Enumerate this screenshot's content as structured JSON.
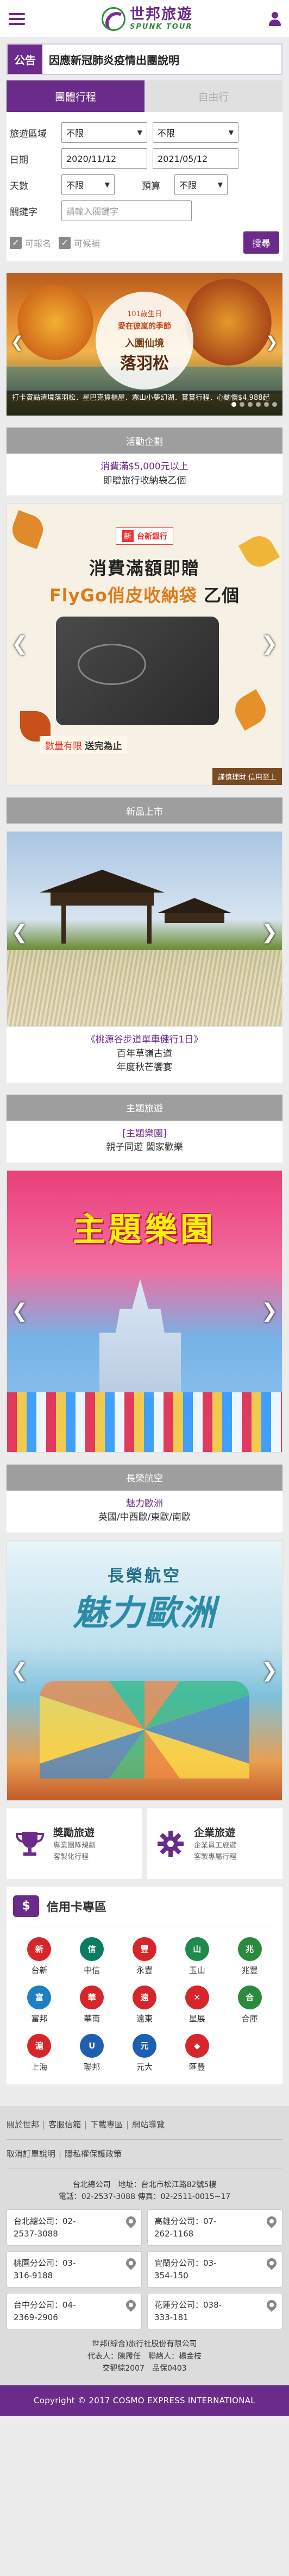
{
  "header": {
    "logo_cn": "世邦旅遊",
    "logo_en": "SPUNK TOUR"
  },
  "notice": {
    "tag": "公告",
    "text": "因應新冠肺炎疫情出團說明"
  },
  "search": {
    "tabs": [
      "團體行程",
      "自由行"
    ],
    "region_label": "旅遊區域",
    "region_value": "不限",
    "region_value2": "不限",
    "date_label": "日期",
    "date_from": "2020/11/12",
    "date_to": "2021/05/12",
    "days_label": "天數",
    "days_value": "不限",
    "budget_label": "預算",
    "budget_value": "不限",
    "keyword_label": "關鍵字",
    "keyword_placeholder": "請輸入關鍵字",
    "check_available": "可報名",
    "check_waitlist": "可候補",
    "search_button": "搜尋"
  },
  "banner": {
    "badge_line1": "101歲生日",
    "badge_line2": "愛在彼嵐的季節",
    "badge_line3": "入園仙境",
    "badge_line4": "落羽松",
    "caption": "打卡賞點清境落羽松．星巴克貨櫃屋．霧山小夢幻湖．賞賞行程．心動價$4,988起"
  },
  "activity": {
    "section_title": "活動企劃",
    "link_line1": "消費滿$5,000元以上",
    "link_line2": "即贈旅行收納袋乙個",
    "bank_name": "台新銀行",
    "headline1": "消費滿額即贈",
    "headline2": "FlyGo俏皮收納袋",
    "headline2_suffix": "乙個",
    "note_prefix": "數量有限",
    "note_suffix": "送完為止",
    "tag": "謹慎理財 信用至上"
  },
  "new_products": {
    "section_title": "新品上市",
    "link_line1": "《桃源谷步道單車健行1日》",
    "link_line2": "百年草嶺古道",
    "link_line3": "年度秋芒饗宴"
  },
  "theme_travel": {
    "section_title": "主題旅遊",
    "link_line1": "[主題樂園]",
    "link_line2": "親子同遊 闔家歡樂",
    "image_title": "主題樂園"
  },
  "airline": {
    "section_title": "長榮航空",
    "link_line1": "魅力歐洲",
    "link_line2": "英國/中西歐/東歐/南歐",
    "image_line1": "長榮航空",
    "image_line2": "魅力歐洲"
  },
  "services": [
    {
      "title": "獎勵旅遊",
      "sub1": "專業團隊規劃",
      "sub2": "客製化行程"
    },
    {
      "title": "企業旅遊",
      "sub1": "企業員工旅遊",
      "sub2": "客製專屬行程"
    }
  ],
  "credit": {
    "icon": "$",
    "title": "信用卡專區",
    "banks": [
      "台新",
      "中信",
      "永豐",
      "玉山",
      "兆豐",
      "富邦",
      "華南",
      "遠東",
      "星展",
      "合庫",
      "上海",
      "聯邦",
      "元大",
      "匯豐"
    ]
  },
  "footer": {
    "links_row1": [
      "關於世邦",
      "客服信箱",
      "下載專區",
      "網站導覽"
    ],
    "links_row2": [
      "取消訂單說明",
      "隱私權保護政策"
    ],
    "hq_line1": "台北總公司　地址：台北市松江路82號5樓",
    "hq_line2": "電話：02-2537-3088 傳真：02-2511-0015~17",
    "branches": [
      {
        "name": "台北總公司：02-",
        "tel": "2537-3088"
      },
      {
        "name": "高雄分公司：07-",
        "tel": "262-1168"
      },
      {
        "name": "桃園分公司：03-",
        "tel": "316-9188"
      },
      {
        "name": "宜蘭分公司：03-",
        "tel": "354-150"
      },
      {
        "name": "台中分公司：04-",
        "tel": "2369-2906"
      },
      {
        "name": "花蓮分公司：038-",
        "tel": "333-181"
      }
    ],
    "company_line1": "世邦(綜合)旅行社股份有限公司",
    "company_line2": "代表人：陳履任　聯絡人：楊金枝",
    "company_line3": "交觀綜2007　品保0403",
    "copyright": "Copyright © 2017 COSMO EXPRESS INTERNATIONAL"
  },
  "colors": {
    "brand_purple": "#6a2b8a",
    "brand_green": "#2e8b3a",
    "bank_red": "#d7252c"
  }
}
